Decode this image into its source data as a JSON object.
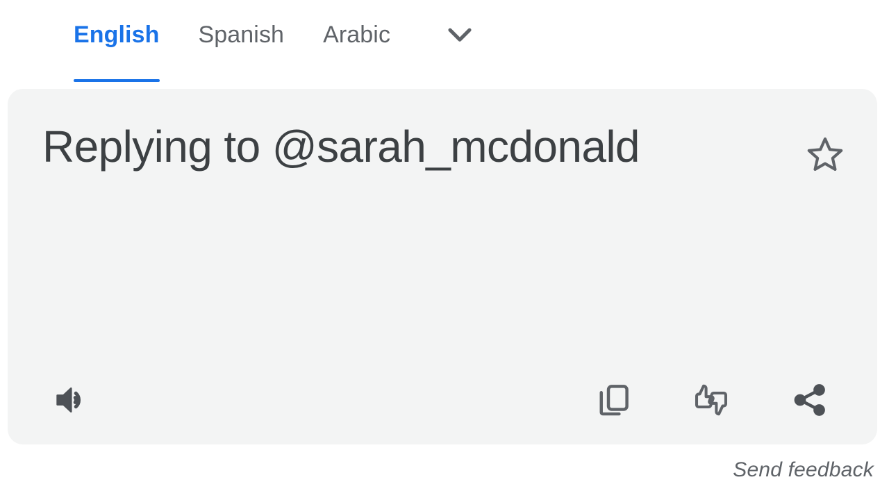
{
  "tabs": [
    {
      "label": "English",
      "active": true
    },
    {
      "label": "Spanish",
      "active": false
    },
    {
      "label": "Arabic",
      "active": false
    }
  ],
  "tab_more": {
    "icon": "chevron-down-icon",
    "label": "More languages"
  },
  "result_card": {
    "text": "Replying to @sarah_mcdonald",
    "star": {
      "icon": "star-outline-icon",
      "label": "Save translation",
      "filled": false
    },
    "actions": {
      "listen": {
        "icon": "volume-up-icon",
        "label": "Listen"
      },
      "copy": {
        "icon": "copy-icon",
        "label": "Copy translation"
      },
      "rate": {
        "icon": "thumbs-up-down-icon",
        "label": "Rate this translation"
      },
      "share": {
        "icon": "share-icon",
        "label": "Share translation"
      }
    }
  },
  "footer": {
    "send_feedback": "Send feedback"
  },
  "colors": {
    "accent": "#1a73e8",
    "text_primary": "#3c4043",
    "text_secondary": "#5f6368",
    "card_background": "#f3f4f4",
    "page_background": "#ffffff"
  }
}
